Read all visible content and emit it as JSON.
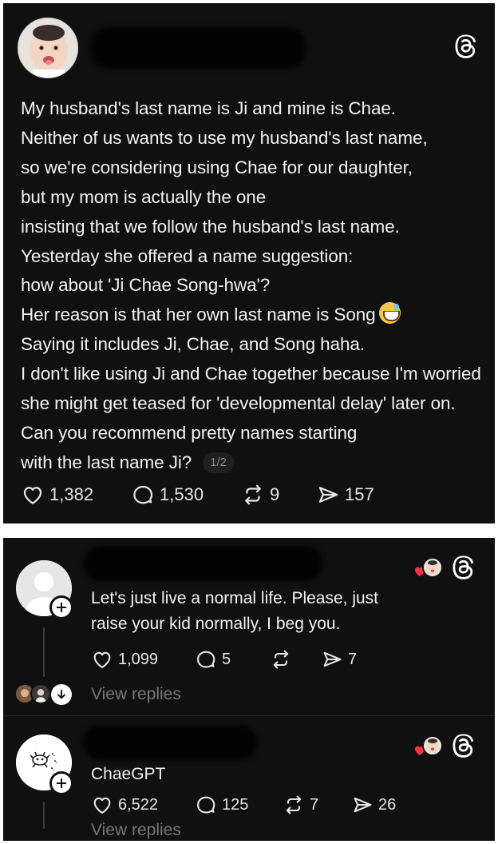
{
  "colors": {
    "background": "#101010",
    "text": "#f2f2f2",
    "muted": "#777777",
    "like_red": "#ff3040"
  },
  "post": {
    "author_redacted": true,
    "lines": [
      "My husband's last name is Ji and mine is Chae.",
      "Neither of us wants to use my husband's last name,",
      "so we're considering using Chae for our daughter,",
      "but my mom is actually the one",
      "insisting that we follow the husband's last name.",
      "Yesterday she offered a name suggestion:",
      "how about 'Ji Chae Song-hwa'?",
      "Her reason is that her own last name is Song",
      "Saying it includes Ji, Chae, and Song haha.",
      "I don't like using Ji and Chae together because I'm worried",
      "she might get teased for 'developmental delay' later on.",
      "Can you recommend pretty names starting",
      "with the last name Ji?"
    ],
    "emoji": "sweat-smile-emoji",
    "page_indicator": "1/2",
    "stats": {
      "likes": "1,382",
      "comments": "1,530",
      "reposts": "9",
      "shares": "157"
    }
  },
  "replies": [
    {
      "author_redacted": true,
      "text_lines": [
        "Let's just live a normal life. Please, just",
        "raise your kid normally, I beg you."
      ],
      "stats": {
        "likes": "1,099",
        "comments": "5",
        "reposts": "",
        "shares": "7"
      },
      "view_replies": "View replies"
    },
    {
      "author_redacted": true,
      "text_lines": [
        "ChaeGPT"
      ],
      "stats": {
        "likes": "6,522",
        "comments": "125",
        "reposts": "7",
        "shares": "26"
      },
      "view_replies": "View replies"
    }
  ],
  "icons": {
    "app_logo": "threads-icon",
    "like": "heart-icon",
    "comment": "comment-bubble-icon",
    "repost": "repost-icon",
    "share": "send-icon",
    "follow": "plus-icon",
    "expand": "arrow-down-icon"
  }
}
